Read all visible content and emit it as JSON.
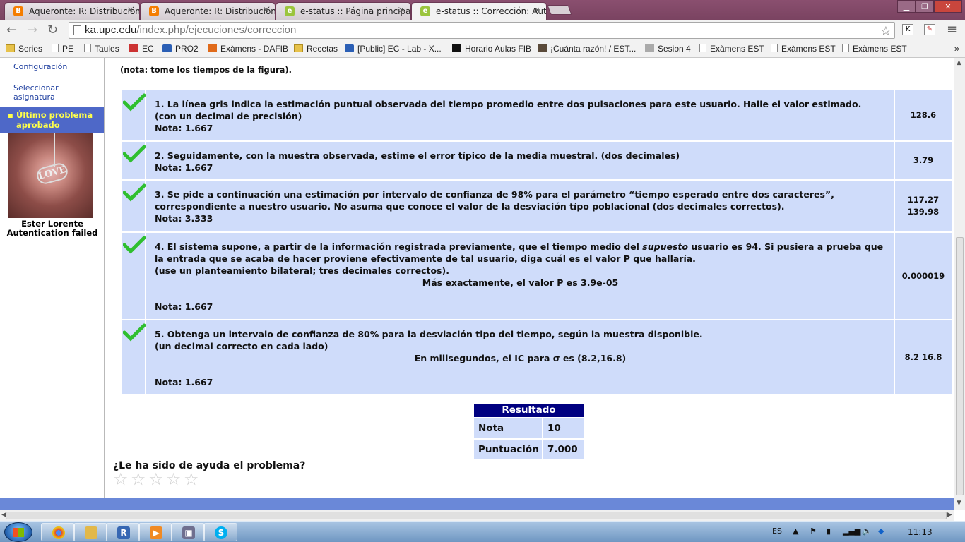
{
  "browser": {
    "tabs": [
      {
        "title": "Aqueronte: R: Distribución",
        "icon": "blogger-icon",
        "color": "#f57d00"
      },
      {
        "title": "Aqueronte: R: Distribución",
        "icon": "blogger-icon",
        "color": "#f57d00"
      },
      {
        "title": "e-status :: Página principal",
        "icon": "estatus-icon",
        "color": "#9bc53d"
      },
      {
        "title": "e-status :: Corrección: Aute",
        "icon": "estatus-icon",
        "color": "#9bc53d"
      }
    ],
    "url_host": "ka.upc.edu",
    "url_path": "/index.php/ejecuciones/correccion",
    "bookmarks": [
      {
        "label": "Series",
        "icon": "folder"
      },
      {
        "label": "PE",
        "icon": "page"
      },
      {
        "label": "Taules",
        "icon": "page"
      },
      {
        "label": "EC",
        "icon": "red"
      },
      {
        "label": "PRO2",
        "icon": "blue"
      },
      {
        "label": "Exàmens - DAFIB",
        "icon": "orange"
      },
      {
        "label": "Recetas",
        "icon": "folder"
      },
      {
        "label": "[Public] EC - Lab - X...",
        "icon": "blue"
      },
      {
        "label": "Horario Aulas FIB",
        "icon": "black"
      },
      {
        "label": "¡Cuánta razón! / EST...",
        "icon": "brown"
      },
      {
        "label": "Sesion 4",
        "icon": "grid"
      },
      {
        "label": "Exàmens EST",
        "icon": "page"
      },
      {
        "label": "Exàmens EST",
        "icon": "page"
      },
      {
        "label": "Exàmens EST",
        "icon": "page"
      }
    ],
    "bookmarks_more": "»"
  },
  "sidebar": {
    "links": [
      "Configuración",
      "Seleccionar asignatura"
    ],
    "active": "Último problema aprobado",
    "user_name": "Ester Lorente",
    "auth_status": "Autentication failed"
  },
  "main": {
    "top_note": "(nota: tome los tiempos de la figura).",
    "questions": [
      {
        "lines": [
          "1. La línea gris indica la estimación puntual observada del tiempo promedio entre dos pulsaciones para este usuario. Halle el valor estimado.",
          "(con un decimal de precisión)"
        ],
        "nota": "Nota: 1.667",
        "answer": [
          "128.6"
        ]
      },
      {
        "lines": [
          "2. Seguidamente, con la muestra observada, estime el error típico de la media muestral. (dos decimales)"
        ],
        "nota": "Nota: 1.667",
        "answer": [
          "3.79"
        ]
      },
      {
        "lines": [
          "3. Se pide a continuación una estimación por intervalo de confianza de 98% para el parámetro “tiempo esperado entre dos caracteres”, correspondiente a nuestro usuario. No asuma que conoce el valor de la desviación típo poblacional (dos decimales correctos)."
        ],
        "nota": "Nota: 3.333",
        "answer": [
          "117.27",
          "139.98"
        ]
      },
      {
        "q4_pre": "4. El sistema supone, a partir de la información registrada previamente, que el tiempo medio del ",
        "q4_em": "supuesto",
        "q4_post": " usuario es 94. Si pusiera a prueba que la entrada que se acaba de hacer proviene efectivamente de tal usuario, diga cuál es el valor P que hallaría.",
        "lines": [
          "(use un planteamiento bilateral; tres decimales correctos)."
        ],
        "center": "Más exactamente, el valor P es 3.9e-05",
        "nota": "Nota: 1.667",
        "answer": [
          "0.000019"
        ]
      },
      {
        "lines": [
          "5. Obtenga un intervalo de confianza de 80% para la desviación tipo del tiempo, según la muestra disponible.",
          "(un decimal correcto en cada lado)"
        ],
        "center": "En milisegundos, el IC para σ es (8.2,16.8)",
        "nota": "Nota: 1.667",
        "answer": [
          "8.2 16.8"
        ]
      }
    ],
    "result": {
      "title": "Resultado",
      "rows": [
        {
          "label": "Nota",
          "value": "10"
        },
        {
          "label": "Puntuación",
          "value": "7.000"
        }
      ]
    },
    "help_question": "¿Le ha sido de ayuda el problema?",
    "rating_stars": 5
  },
  "taskbar": {
    "language": "ES",
    "clock": "11:13",
    "apps": [
      "chrome-icon",
      "explorer-icon",
      "r-icon",
      "media-player-icon",
      "virtualbox-icon",
      "skype-icon"
    ]
  },
  "colors": {
    "accent": "#4e68c8",
    "row_bg": "#cfdcfa",
    "result_header": "#000080",
    "check": "#2fbf2f"
  }
}
